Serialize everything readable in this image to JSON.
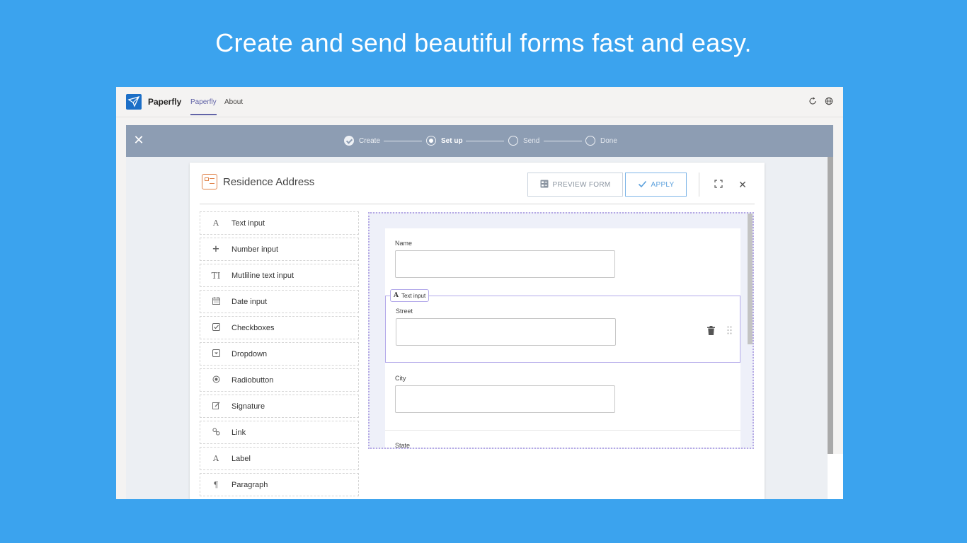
{
  "headline": "Create and send beautiful forms fast and easy.",
  "app": {
    "name": "Paperfly",
    "tabs": [
      {
        "label": "Paperfly",
        "active": true
      },
      {
        "label": "About",
        "active": false
      }
    ],
    "icons": [
      "refresh-icon",
      "globe-icon"
    ]
  },
  "wizard": {
    "close_icon": "close-icon",
    "steps": [
      {
        "label": "Create",
        "state": "done"
      },
      {
        "label": "Set up",
        "state": "current"
      },
      {
        "label": "Send",
        "state": "pending"
      },
      {
        "label": "Done",
        "state": "pending"
      }
    ]
  },
  "dialog": {
    "title": "Residence Address",
    "preview_label": "PREVIEW FORM",
    "apply_label": "APPLY",
    "icons": [
      "form-icon",
      "preview-icon",
      "check-icon",
      "expand-icon",
      "close-icon"
    ]
  },
  "palette": [
    {
      "label": "Text input",
      "icon": "A"
    },
    {
      "label": "Number input",
      "icon": "+"
    },
    {
      "label": "Mutliline text input",
      "icon": "TI"
    },
    {
      "label": "Date input",
      "icon": "calendar"
    },
    {
      "label": "Checkboxes",
      "icon": "checkbox"
    },
    {
      "label": "Dropdown",
      "icon": "dropdown"
    },
    {
      "label": "Radiobutton",
      "icon": "radio"
    },
    {
      "label": "Signature",
      "icon": "pen"
    },
    {
      "label": "Link",
      "icon": "link"
    },
    {
      "label": "Label",
      "icon": "A"
    },
    {
      "label": "Paragraph",
      "icon": "¶"
    }
  ],
  "form": {
    "fields": [
      {
        "label": "Name",
        "selected": false
      },
      {
        "label": "Street",
        "selected": true,
        "tag": "Text input"
      },
      {
        "label": "City",
        "selected": false
      },
      {
        "label": "State",
        "selected": false
      }
    ]
  },
  "colors": {
    "background": "#3ba3ee",
    "step_bar": "#8d9db3",
    "accent": "#6264a7",
    "selection": "#b3a9ea"
  }
}
